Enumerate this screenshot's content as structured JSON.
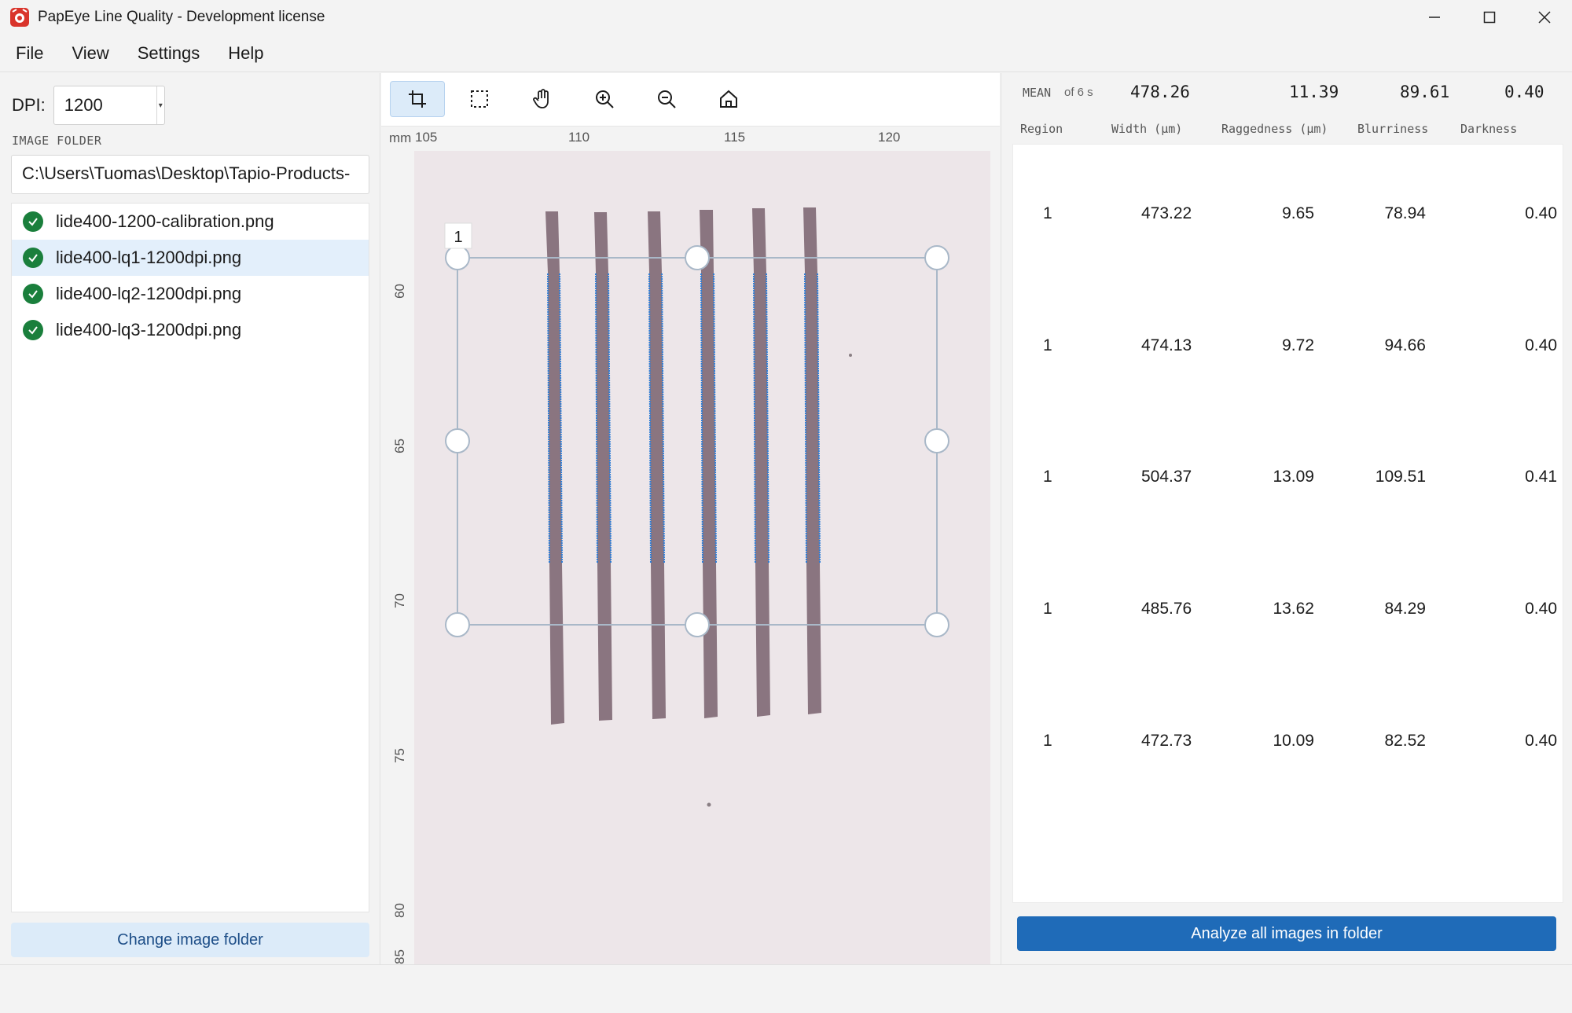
{
  "window": {
    "title": "PapEye Line Quality - Development license",
    "minimize_icon": "minimize-icon",
    "maximize_icon": "maximize-icon",
    "close_icon": "close-icon"
  },
  "menu": [
    "File",
    "View",
    "Settings",
    "Help"
  ],
  "left": {
    "dpi_label": "DPI:",
    "dpi_value": "1200",
    "folder_label": "IMAGE FOLDER",
    "folder_path": "C:\\Users\\Tuomas\\Desktop\\Tapio-Products-",
    "files": [
      {
        "name": "lide400-1200-calibration.png",
        "selected": false
      },
      {
        "name": "lide400-lq1-1200dpi.png",
        "selected": true
      },
      {
        "name": "lide400-lq2-1200dpi.png",
        "selected": false
      },
      {
        "name": "lide400-lq3-1200dpi.png",
        "selected": false
      }
    ],
    "change_folder_label": "Change image folder"
  },
  "toolbar": {
    "tools": [
      "crop-icon",
      "select-region-icon",
      "pan-hand-icon",
      "zoom-in-icon",
      "zoom-out-icon",
      "home-icon"
    ],
    "active_tool": "crop-icon"
  },
  "viewer": {
    "ruler_unit": "mm",
    "x_ticks": [
      "105",
      "110",
      "115",
      "120"
    ],
    "y_ticks": [
      "60",
      "65",
      "70",
      "75",
      "80",
      "85"
    ],
    "region_label": "1"
  },
  "right": {
    "mean_label": "MEAN",
    "mean_of": "of 6 s",
    "mean_values": [
      "478.26",
      "11.39",
      "89.61",
      "0.40"
    ],
    "columns": [
      "Region",
      "Width (µm)",
      "Raggedness (µm)",
      "Blurriness",
      "Darkness"
    ],
    "rows": [
      [
        "1",
        "473.22",
        "9.65",
        "78.94",
        "0.40"
      ],
      [
        "1",
        "474.13",
        "9.72",
        "94.66",
        "0.40"
      ],
      [
        "1",
        "504.37",
        "13.09",
        "109.51",
        "0.41"
      ],
      [
        "1",
        "485.76",
        "13.62",
        "84.29",
        "0.40"
      ],
      [
        "1",
        "472.73",
        "10.09",
        "82.52",
        "0.40"
      ]
    ],
    "analyze_label": "Analyze all images in folder"
  },
  "colors": {
    "accent": "#1f6bb8",
    "selection": "#e3effb",
    "check": "#1a7f3c",
    "line": "#8a7580",
    "edge": "#2e7dd6"
  }
}
